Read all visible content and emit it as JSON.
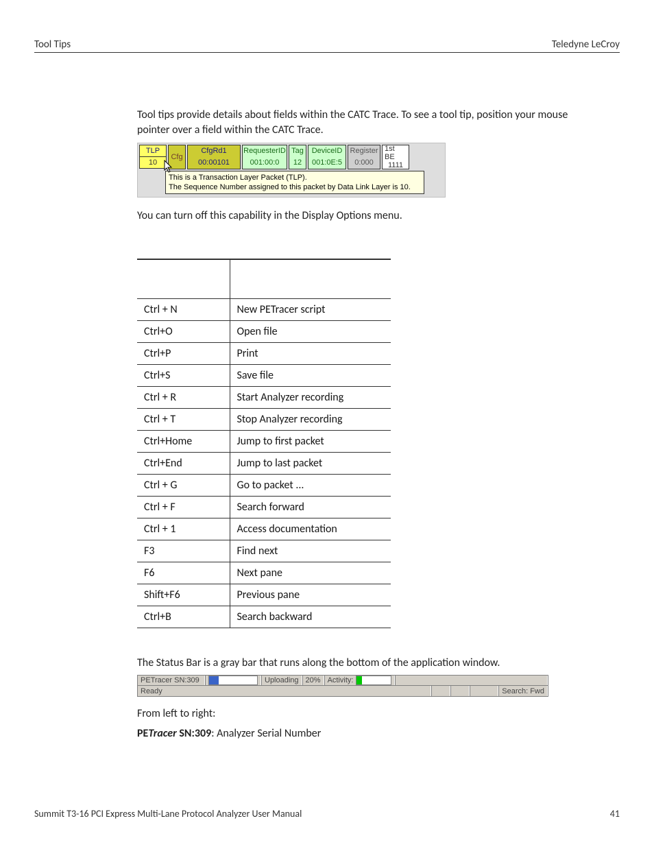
{
  "header": {
    "left": "Tool Tips",
    "right": "Teledyne LeCroy"
  },
  "intro1": "Tool tips provide details about fields within the CATC Trace. To see a tool tip, position your mouse pointer over a field within the CATC Trace.",
  "traceFig": {
    "tlpLabel": "TLP",
    "tlpIndex": "10",
    "cfgLabel": "Cfg",
    "cfgrdTop": "CfgRd1",
    "cfgrdBot": "00:00101",
    "reqIdTop": "RequesterID",
    "reqIdBot": "001:00:0",
    "tagTop": "Tag",
    "tagBot": "12",
    "devIdTop": "DeviceID",
    "devIdBot": "001:0E:5",
    "registerTop": "Register",
    "registerBot": "0:000",
    "beTop": "1st BE",
    "beBot": "1111",
    "tooltipLine1": "This is a Transaction Layer Packet (TLP).",
    "tooltipLine2": "The Sequence Number assigned to this packet by Data Link Layer is 10."
  },
  "intro2": "You can turn off this capability in the Display Options menu.",
  "shortcuts": [
    {
      "key": "Ctrl + N",
      "desc_pre": "New PE",
      "desc_ital": "Tracer",
      "desc_post": " script"
    },
    {
      "key": "Ctrl+O",
      "desc": "Open file"
    },
    {
      "key": "Ctrl+P",
      "desc": "Print"
    },
    {
      "key": "Ctrl+S",
      "desc": "Save file"
    },
    {
      "key": "Ctrl + R",
      "desc": "Start Analyzer recording"
    },
    {
      "key": "Ctrl + T",
      "desc": "Stop Analyzer recording"
    },
    {
      "key": "Ctrl+Home",
      "desc": "Jump to first packet"
    },
    {
      "key": "Ctrl+End",
      "desc": "Jump to last packet"
    },
    {
      "key": "Ctrl + G",
      "desc": "Go to packet ..."
    },
    {
      "key": "Ctrl + F",
      "desc": "Search forward"
    },
    {
      "key": "Ctrl + 1",
      "desc": "Access documentation"
    },
    {
      "key": "F3",
      "desc": "Find next"
    },
    {
      "key": "F6",
      "desc": "Next pane"
    },
    {
      "key": "Shift+F6",
      "desc": "Previous pane"
    },
    {
      "key": "Ctrl+B",
      "desc": "Search backward"
    }
  ],
  "statusIntro": "The Status Bar is a gray bar that runs along the bottom of the application window.",
  "statusBar": {
    "analyzer": "PETracer SN:309",
    "uploading": "Uploading",
    "pct": "20%",
    "activity": "Activity:",
    "ready": "Ready",
    "search": "Search: Fwd",
    "progressPercent": 20
  },
  "afterStatus": "From left to right:",
  "snLine_bold_pre": "PE",
  "snLine_bold_ital": "Tracer",
  "snLine_bold_post": " SN:309",
  "snLine_rest": ": Analyzer Serial Number",
  "footer": {
    "left": "Summit T3-16 PCI Express Multi-Lane Protocol Analyzer User Manual",
    "right": "41"
  }
}
